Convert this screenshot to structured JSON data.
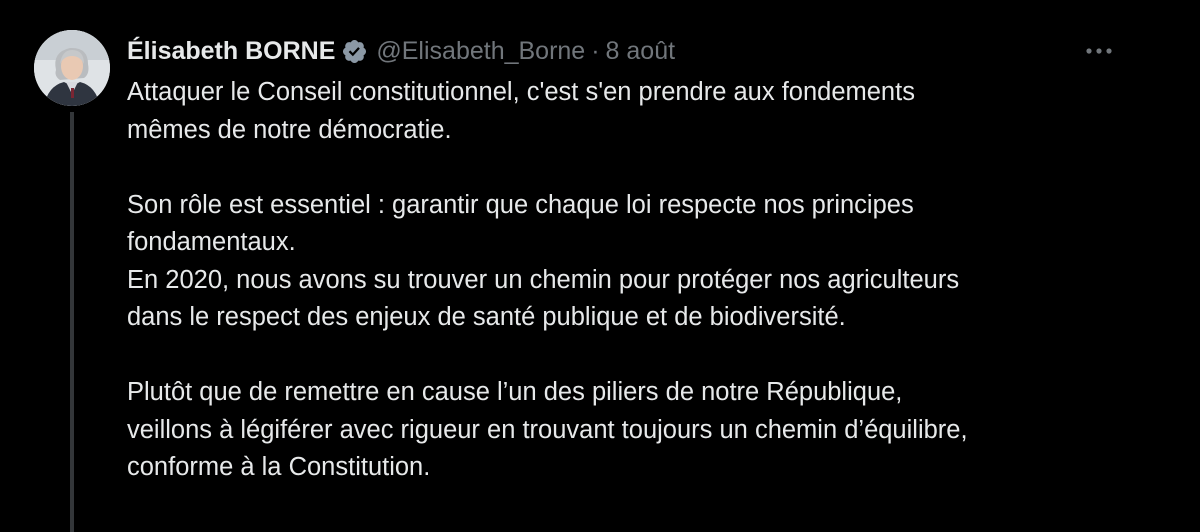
{
  "tweet": {
    "display_name": "Élisabeth BORNE",
    "handle": "@Elisabeth_Borne",
    "separator": "·",
    "date": "8 août",
    "verified_icon": "verified-badge-icon",
    "more_icon": "more-options-icon",
    "avatar_icon": "user-avatar",
    "colors": {
      "background": "#000000",
      "text": "#e7e9ea",
      "muted": "#71767b",
      "verified": "#8b98a5",
      "thread_line": "#333639"
    },
    "paragraphs": [
      {
        "lines": [
          "Attaquer le Conseil constitutionnel, c'est s'en prendre aux fondements",
          "mêmes de notre démocratie."
        ]
      },
      {
        "lines": [
          "Son rôle est essentiel : garantir que chaque loi respecte nos principes",
          "fondamentaux.",
          "En 2020, nous avons su trouver un chemin pour protéger nos agriculteurs",
          "dans le respect des enjeux de santé publique et de biodiversité."
        ]
      },
      {
        "lines": [
          "Plutôt que de remettre en cause l’un des piliers de notre République,",
          "veillons à légiférer avec rigueur en trouvant toujours un chemin d’équilibre,",
          "conforme à la Constitution."
        ]
      }
    ]
  }
}
